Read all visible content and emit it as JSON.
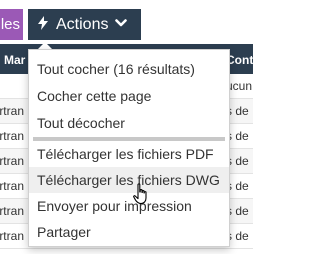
{
  "toolbar": {
    "prev_button_label": "les",
    "actions_button_label": "Actions",
    "actions_icon": "bolt-icon",
    "actions_chevron_icon": "chevron-down-icon"
  },
  "table": {
    "headers": [
      {
        "label": "Mar"
      },
      {
        "label": "Cont"
      }
    ],
    "rows": [
      {
        "left": "",
        "right": "ucun"
      },
      {
        "left": "ertran",
        "right": "s de"
      },
      {
        "left": "ertran",
        "right": "s de"
      },
      {
        "left": "ertran",
        "right": "s de"
      },
      {
        "left": "ertran",
        "right": "s de"
      },
      {
        "left": "ertran",
        "right": "s de"
      },
      {
        "left": "ertran",
        "right": "s de"
      },
      {
        "left": "ertran",
        "right": "s de"
      }
    ]
  },
  "menu": {
    "items": [
      {
        "label": "Tout cocher (16 résultats)"
      },
      {
        "label": "Cocher cette page"
      },
      {
        "label": "Tout décocher"
      },
      {
        "label": "Télécharger les fichiers PDF"
      },
      {
        "label": "Télécharger les fichiers DWG"
      },
      {
        "label": "Envoyer pour impression"
      },
      {
        "label": "Partager"
      }
    ],
    "hovered_item": "Télécharger les fichiers DWG"
  },
  "cursor": {
    "icon": "hand-pointer-icon"
  },
  "colors": {
    "accent_purple": "#9b59b6",
    "toolbar_dark": "#2c3e50",
    "menu_hover": "#efefef"
  }
}
